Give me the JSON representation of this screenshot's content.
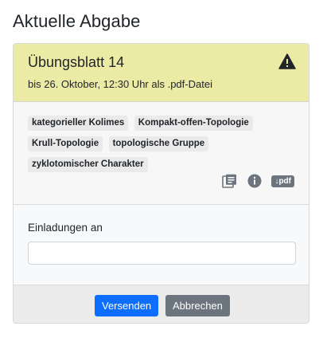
{
  "page": {
    "title": "Aktuelle Abgabe"
  },
  "assignment": {
    "title": "Übungsblatt 14",
    "deadline": "bis 26. Oktober, 12:30 Uhr als .pdf-Datei",
    "header_color": "#eceba6"
  },
  "tags": [
    "kategorieller Kolimes",
    "Kompakt-offen-Topologie",
    "Krull-Topologie",
    "topologische Gruppe",
    "zyklotomischer Charakter"
  ],
  "icons": {
    "warning": "warning-icon",
    "list": "document-list-icon",
    "info": "info-icon",
    "pdf_label": "↓pdf"
  },
  "invite": {
    "label": "Einladungen an",
    "value": "",
    "placeholder": ""
  },
  "footer": {
    "send_label": "Versenden",
    "cancel_label": "Abbrechen",
    "primary_color": "#0d6efd",
    "secondary_color": "#6c757d"
  }
}
